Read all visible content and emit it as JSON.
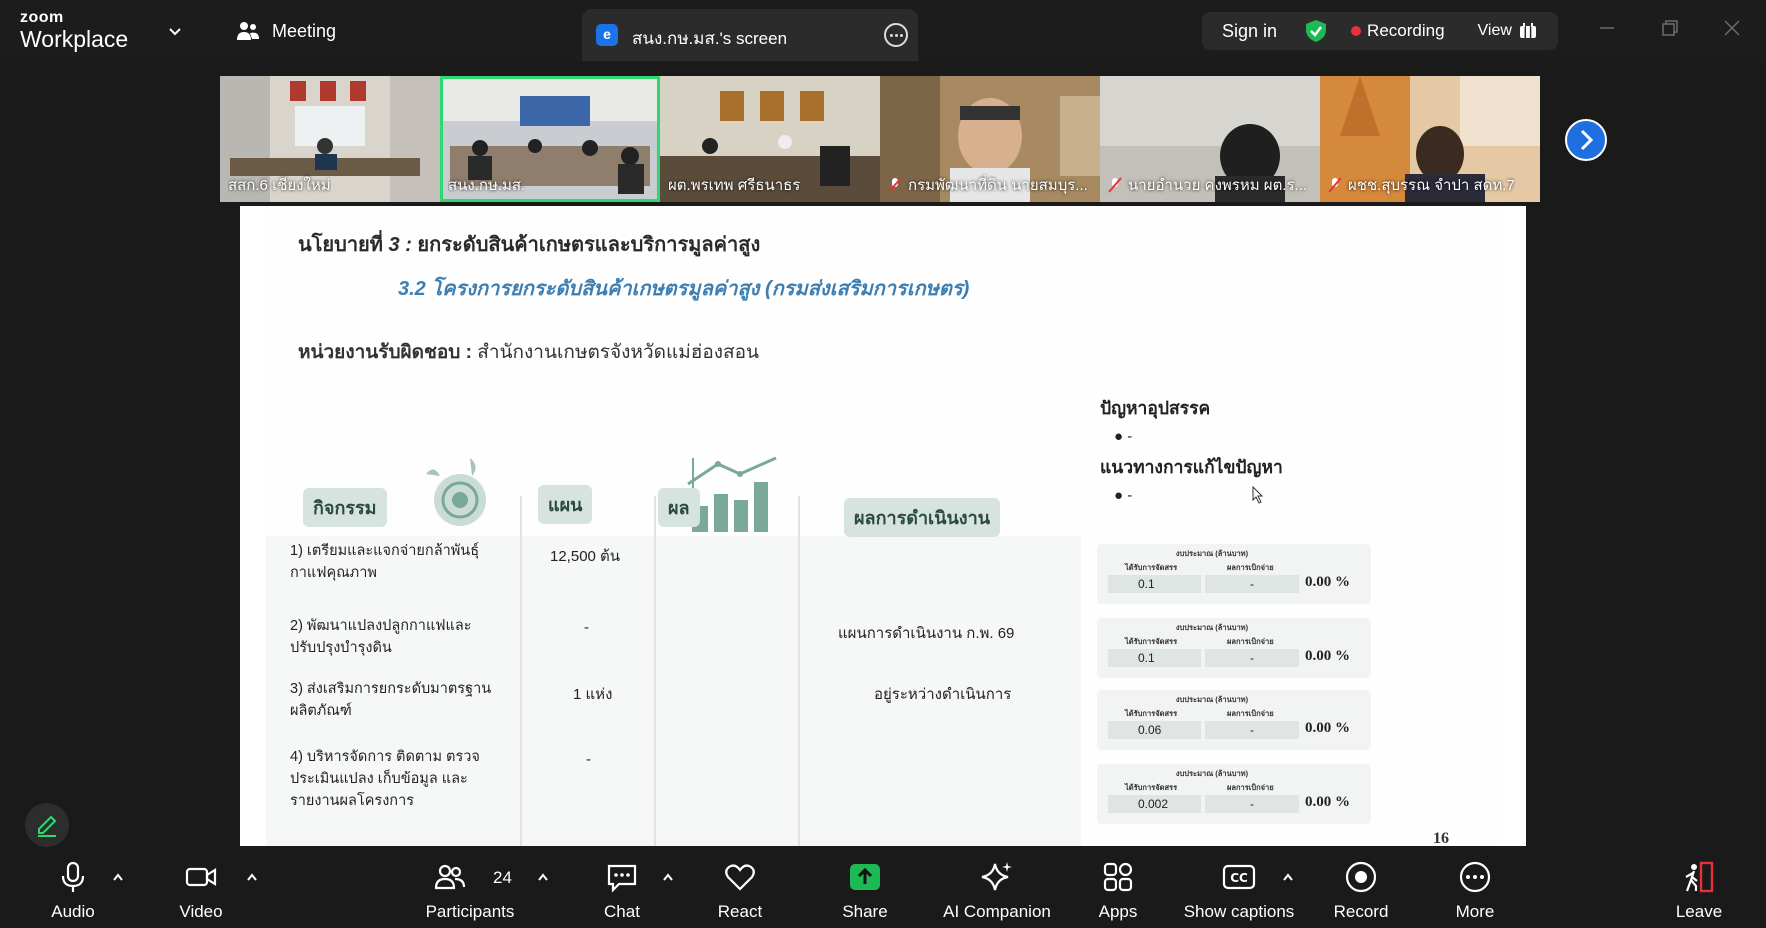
{
  "app": {
    "logo_top": "zoom",
    "logo_bottom": "Workplace",
    "meeting_label": "Meeting",
    "share_tab_badge": "e",
    "share_tab_label": "สนง.กษ.มส.'s screen",
    "sign_in": "Sign in",
    "recording": "Recording",
    "view": "View"
  },
  "participants_strip": [
    {
      "name": "สสก.6 เชียงใหม่",
      "muted": false,
      "active": false
    },
    {
      "name": "สนง.กษ.มส.",
      "muted": false,
      "active": true
    },
    {
      "name": "ผต.พรเทพ  ศรีธนาธร",
      "muted": false,
      "active": false
    },
    {
      "name": "กรมพัฒนาที่ดิน นายสมบุร...",
      "muted": true,
      "active": false
    },
    {
      "name": "นายอำนวย คงพรหม ผต.ร...",
      "muted": true,
      "active": false
    },
    {
      "name": "ผชช.สุบรรณ จำปา สดท.7",
      "muted": true,
      "active": false
    }
  ],
  "slide": {
    "title_prefix": "นโยบายที่ ",
    "title_num": "3 :",
    "title_rest": " ยกระดับสินค้าเกษตรและบริการมูลค่าสูง",
    "subtitle": "3.2 โครงการยกระดับสินค้าเกษตรมูลค่าสูง (กรมส่งเสริมการเกษตร)",
    "resp_label": "หน่วยงานรับผิดชอบ :",
    "resp_value": " สำนักงานเกษตรจังหวัดแม่ฮ่องสอน",
    "col_activity": "กิจกรรม",
    "col_plan": "แผน",
    "col_result": "ผล",
    "col_progress": "ผลการดำเนินงาน",
    "rows": [
      {
        "activity": "1) เตรียมและแจกจ่ายกล้าพันธุ์กาแฟคุณภาพ",
        "plan": "12,500 ต้น",
        "progress": ""
      },
      {
        "activity": "2) พัฒนาแปลงปลูกกาแฟและปรับปรุงบำรุงดิน",
        "plan": "-",
        "progress": "แผนการดำเนินงาน ก.พ. 69"
      },
      {
        "activity": "3) ส่งเสริมการยกระดับมาตรฐานผลิตภัณฑ์",
        "plan": "1 แห่ง",
        "progress": "อยู่ระหว่างดำเนินการ"
      },
      {
        "activity": "4) บริหารจัดการ ติดตาม ตรวจประเมินแปลง เก็บข้อมูล และรายงานผลโครงการ",
        "plan": "-",
        "progress": ""
      }
    ],
    "problems_head": "ปัญหาอุปสรรค",
    "problems_item": "-",
    "solutions_head": "แนวทางการแก้ไขปัญหา",
    "solutions_item": "-",
    "budget_title": "งบประมาณ (ล้านบาท)",
    "budget_alloc_label": "ได้รับการจัดสรร",
    "budget_spent_label": "ผลการเบิกจ่าย",
    "budgets": [
      {
        "alloc": "0.1",
        "spent": "-",
        "pct": "0.00 %"
      },
      {
        "alloc": "0.1",
        "spent": "-",
        "pct": "0.00 %"
      },
      {
        "alloc": "0.06",
        "spent": "-",
        "pct": "0.00 %"
      },
      {
        "alloc": "0.002",
        "spent": "-",
        "pct": "0.00 %"
      }
    ],
    "page_number": "16"
  },
  "toolbar": {
    "audio": "Audio",
    "video": "Video",
    "participants": "Participants",
    "participants_count": "24",
    "chat": "Chat",
    "react": "React",
    "share": "Share",
    "ai_companion": "AI Companion",
    "apps": "Apps",
    "show_captions": "Show captions",
    "record": "Record",
    "more": "More",
    "leave": "Leave"
  },
  "colors": {
    "share_green": "#1db954",
    "active_outline": "#2bd96f",
    "leave_red": "#e5323a",
    "accent_blue": "#1f6fe0",
    "slide_subtitle_blue": "#3d7fb3"
  }
}
